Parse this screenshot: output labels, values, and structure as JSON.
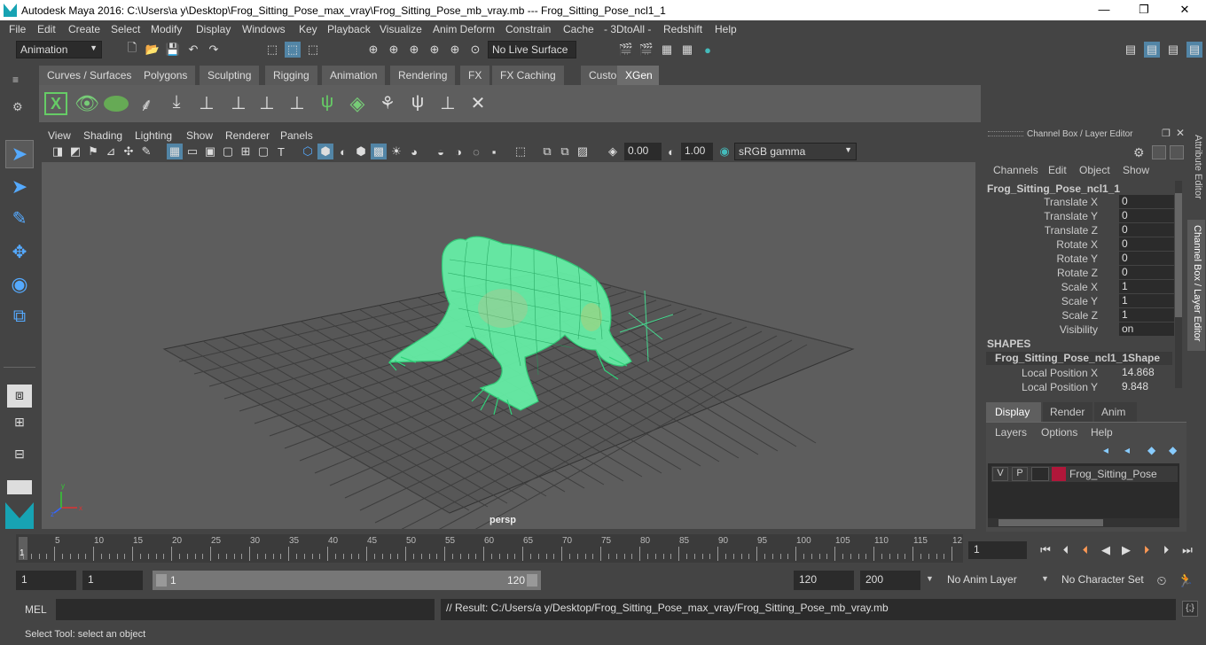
{
  "window": {
    "title": "Autodesk Maya 2016: C:\\Users\\a y\\Desktop\\Frog_Sitting_Pose_max_vray\\Frog_Sitting_Pose_mb_vray.mb  ---  Frog_Sitting_Pose_ncl1_1",
    "minimize": "—",
    "maximize": "❐",
    "close": "✕"
  },
  "menu": [
    "File",
    "Edit",
    "Create",
    "Select",
    "Modify",
    "Display",
    "Windows",
    "Key",
    "Playback",
    "Visualize",
    "Anim Deform",
    "Constrain",
    "Cache",
    "- 3DtoAll -",
    "Redshift",
    "Help"
  ],
  "status": {
    "mode": "Animation",
    "live_surface": "No Live Surface"
  },
  "shelf_tabs": [
    "Curves / Surfaces",
    "Polygons",
    "Sculpting",
    "Rigging",
    "Animation",
    "Rendering",
    "FX",
    "FX Caching",
    "Custom",
    "XGen"
  ],
  "active_shelf_tab": "XGen",
  "viewport": {
    "menu": [
      "View",
      "Shading",
      "Lighting",
      "Show",
      "Renderer",
      "Panels"
    ],
    "exposure": "0.00",
    "gamma": "1.00",
    "color_space": "sRGB gamma",
    "camera_label": "persp"
  },
  "channel_box": {
    "header": "Channel Box / Layer Editor",
    "menu": [
      "Channels",
      "Edit",
      "Object",
      "Show"
    ],
    "object_name": "Frog_Sitting_Pose_ncl1_1",
    "attributes": [
      {
        "label": "Translate X",
        "value": "0"
      },
      {
        "label": "Translate Y",
        "value": "0"
      },
      {
        "label": "Translate Z",
        "value": "0"
      },
      {
        "label": "Rotate X",
        "value": "0"
      },
      {
        "label": "Rotate Y",
        "value": "0"
      },
      {
        "label": "Rotate Z",
        "value": "0"
      },
      {
        "label": "Scale X",
        "value": "1"
      },
      {
        "label": "Scale Y",
        "value": "1"
      },
      {
        "label": "Scale Z",
        "value": "1"
      },
      {
        "label": "Visibility",
        "value": "on"
      }
    ],
    "shapes_header": "SHAPES",
    "shape_name": "Frog_Sitting_Pose_ncl1_1Shape",
    "shape_attributes": [
      {
        "label": "Local Position X",
        "value": "14.868"
      },
      {
        "label": "Local Position Y",
        "value": "9.848"
      }
    ]
  },
  "layer_editor": {
    "tabs": [
      "Display",
      "Render",
      "Anim"
    ],
    "menu": [
      "Layers",
      "Options",
      "Help"
    ],
    "layer": {
      "v": "V",
      "p": "P",
      "name": "Frog_Sitting_Pose",
      "color": "#b0173a"
    }
  },
  "side_tabs": [
    "Attribute Editor",
    "Channel Box / Layer Editor"
  ],
  "timeline": {
    "ticks": [
      "5",
      "10",
      "15",
      "20",
      "25",
      "30",
      "35",
      "40",
      "45",
      "50",
      "55",
      "60",
      "65",
      "70",
      "75",
      "80",
      "85",
      "90",
      "95",
      "100",
      "105",
      "110",
      "115",
      "12"
    ],
    "first_frame": "1",
    "current_frame": "1"
  },
  "range": {
    "start": "1",
    "playback_start": "1",
    "slider_start": "1",
    "slider_end": "120",
    "playback_end": "120",
    "end": "200",
    "anim_layer": "No Anim Layer",
    "character_set": "No Character Set"
  },
  "command": {
    "mode": "MEL",
    "result": "// Result: C:/Users/a y/Desktop/Frog_Sitting_Pose_max_vray/Frog_Sitting_Pose_mb_vray.mb"
  },
  "help_line": "Select Tool: select an object"
}
